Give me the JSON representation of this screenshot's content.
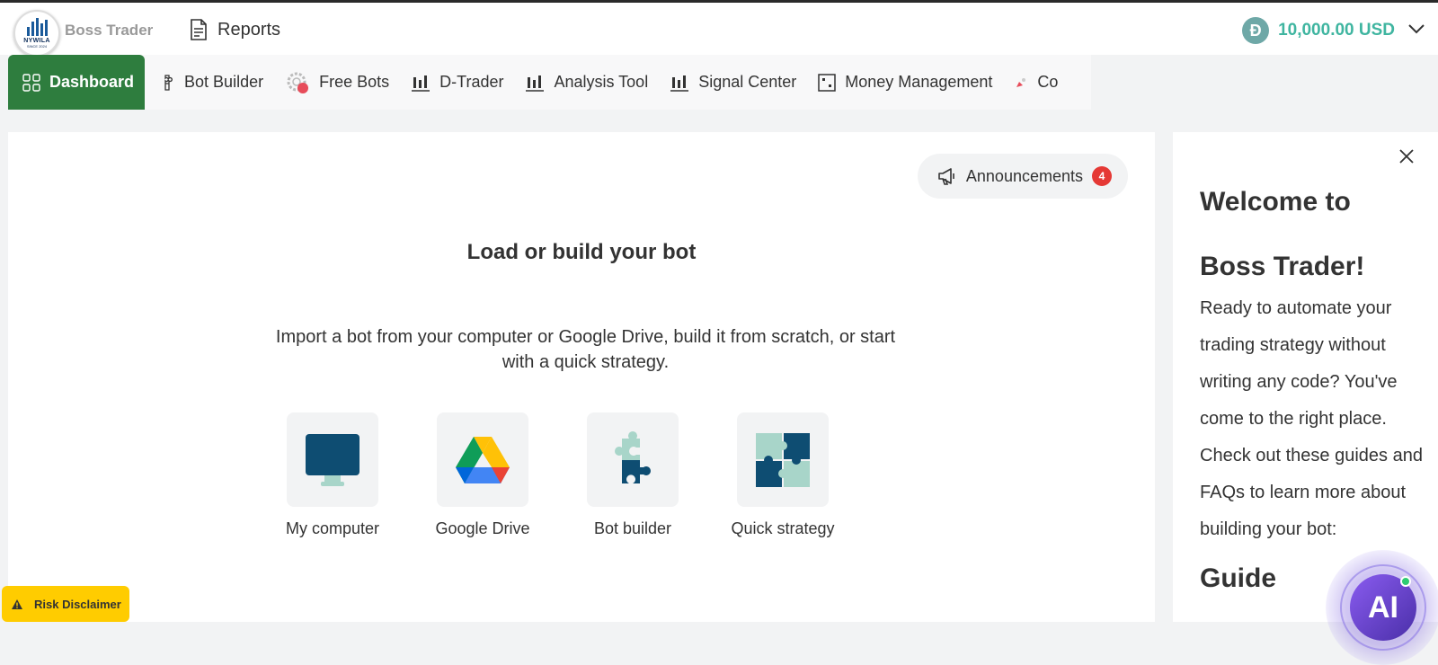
{
  "header": {
    "logo_text": "NYWILA",
    "logo_sub": "SINCE 2024",
    "brand": "Boss Trader",
    "reports_label": "Reports",
    "balance": "10,000.00 USD",
    "coin_symbol": "Đ",
    "accent_color": "#3fb5a0"
  },
  "tabs": [
    {
      "label": "Dashboard",
      "icon": "dashboard-grid-icon",
      "active": true
    },
    {
      "label": "Bot Builder",
      "icon": "puzzle-icon"
    },
    {
      "label": "Free Bots",
      "icon": "gear-icon"
    },
    {
      "label": "D-Trader",
      "icon": "candlestick-icon"
    },
    {
      "label": "Analysis Tool",
      "icon": "candlestick-icon"
    },
    {
      "label": "Signal Center",
      "icon": "candlestick-icon"
    },
    {
      "label": "Money Management",
      "icon": "dice-icon"
    },
    {
      "label": "Co",
      "icon": "rocket-icon"
    }
  ],
  "main": {
    "announcements_label": "Announcements",
    "announcements_count": "4",
    "title": "Load or build your bot",
    "description": "Import a bot from your computer or Google Drive, build it from scratch, or start with a quick strategy.",
    "cards": [
      {
        "label": "My computer",
        "icon": "monitor-icon"
      },
      {
        "label": "Google Drive",
        "icon": "google-drive-icon"
      },
      {
        "label": "Bot builder",
        "icon": "puzzle-piece-icon"
      },
      {
        "label": "Quick strategy",
        "icon": "puzzle-grid-icon"
      }
    ]
  },
  "side": {
    "welcome_line1": "Welcome to",
    "welcome_line2": "Boss Trader!",
    "description": "Ready to automate your trading strategy without writing any code? You've come to the right place. Check out these guides and FAQs to learn more about building your bot:",
    "guide_heading": "Guide"
  },
  "risk_label": "Risk Disclaimer",
  "ai_label": "AI"
}
